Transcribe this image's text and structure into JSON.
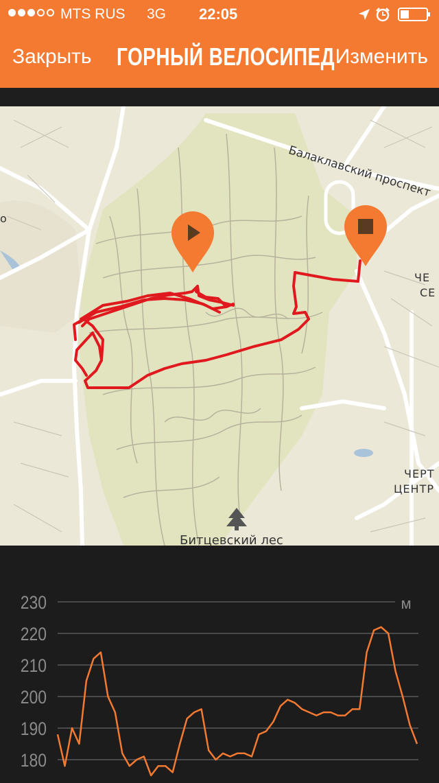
{
  "status_bar": {
    "carrier": "MTS RUS",
    "network": "3G",
    "time": "22:05",
    "signal_bars": 3,
    "signal_total": 5
  },
  "nav": {
    "close_label": "Закрыть",
    "title": "ГОРНЫЙ ВЕЛОСИПЕД",
    "edit_label": "Изменить"
  },
  "map": {
    "labels": {
      "street": "Балаклавский проспект",
      "district1_line1": "ЧЕ",
      "district1_line2": "СЕ",
      "district2_line1": "ЧЕРТ",
      "district2_line2": "ЦЕНТР",
      "forest": "Битцевский лес",
      "edge_left": "о"
    },
    "start_icon": "play-icon",
    "finish_icon": "stop-icon",
    "route_color": "#e0191f",
    "marker_color": "#f37a30"
  },
  "chart_data": {
    "type": "line",
    "unit": "м",
    "y_ticks": [
      230,
      220,
      210,
      200,
      190,
      180
    ],
    "ylim": [
      175,
      230
    ],
    "line_color": "#f37a30",
    "x": [
      0,
      2,
      4,
      6,
      8,
      10,
      12,
      14,
      16,
      18,
      20,
      22,
      24,
      26,
      28,
      30,
      32,
      34,
      36,
      38,
      40,
      42,
      44,
      46,
      48,
      50,
      52,
      54,
      56,
      58,
      60,
      62,
      64,
      66,
      68,
      70,
      72,
      74,
      76,
      78,
      80,
      82,
      84,
      86,
      88,
      90,
      92,
      94,
      96,
      98,
      100
    ],
    "values": [
      188,
      178,
      190,
      185,
      205,
      212,
      214,
      200,
      195,
      182,
      178,
      180,
      181,
      175,
      178,
      178,
      176,
      185,
      193,
      195,
      196,
      183,
      180,
      182,
      181,
      182,
      182,
      181,
      188,
      189,
      192,
      197,
      199,
      198,
      196,
      195,
      194,
      195,
      195,
      194,
      194,
      196,
      196,
      214,
      221,
      222,
      220,
      208,
      200,
      191,
      185
    ]
  }
}
